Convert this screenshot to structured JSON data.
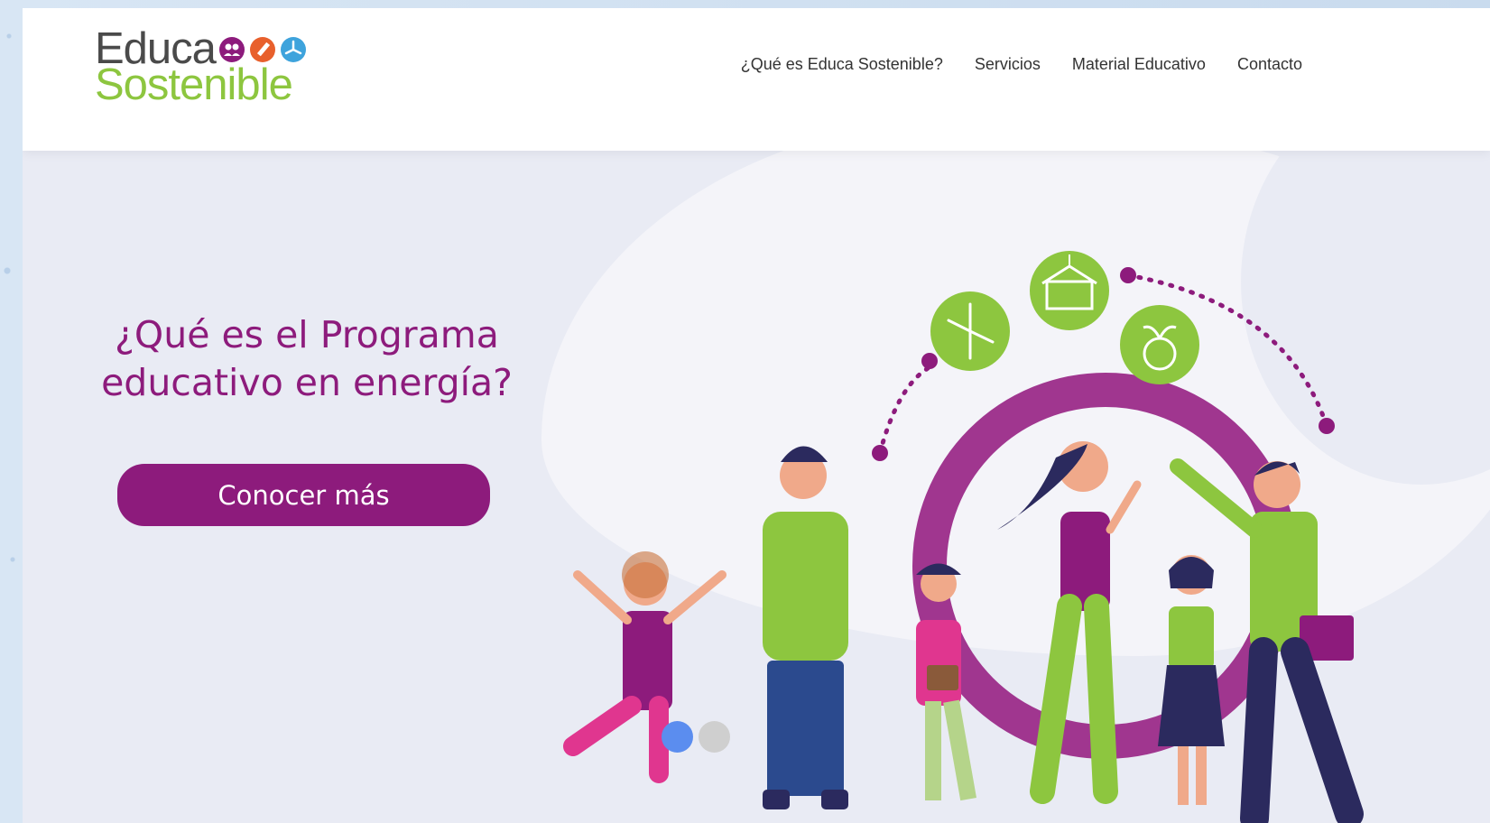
{
  "brand": {
    "name_line1": "Educa",
    "name_line2": "Sostenible",
    "colors": {
      "gray": "#4a4a4a",
      "green": "#8dc63f",
      "purple": "#8d1b7c",
      "orange": "#e8602c",
      "blue": "#3ea3dc"
    },
    "logo_icons": [
      "people-icon",
      "pencil-icon",
      "wind-turbine-icon"
    ]
  },
  "nav": {
    "items": [
      {
        "label": "¿Qué es Educa Sostenible?"
      },
      {
        "label": "Servicios"
      },
      {
        "label": "Material Educativo"
      },
      {
        "label": "Contacto"
      }
    ]
  },
  "hero": {
    "title_line1": "¿Qué es el Programa",
    "title_line2": "educativo en energía?",
    "cta_label": "Conocer más",
    "carousel": {
      "slides": 2,
      "active_index": 0,
      "active_color": "#5b8def",
      "inactive_color": "#cfcfcf"
    },
    "illustration_icons": [
      "wind-turbine-icon",
      "school-icon",
      "earth-sprout-icon"
    ]
  }
}
